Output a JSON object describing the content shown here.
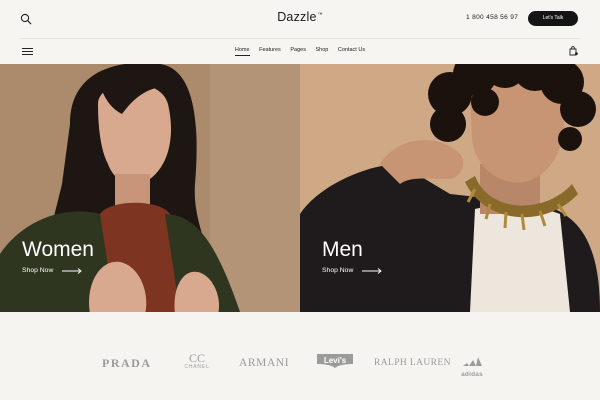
{
  "header": {
    "logo": "Dazzle",
    "logo_mark": "™",
    "phone": "1 800 458 56 97",
    "cta_label": "Let's Talk"
  },
  "nav": {
    "items": [
      {
        "label": "Home",
        "active": true
      },
      {
        "label": "Features",
        "active": false
      },
      {
        "label": "Pages",
        "active": false
      },
      {
        "label": "Shop",
        "active": false
      },
      {
        "label": "Contact Us",
        "active": false
      }
    ]
  },
  "icons": {
    "search": "search-icon",
    "menu": "hamburger-menu-icon",
    "cart": "shopping-bag-icon",
    "arrow": "arrow-right-icon"
  },
  "hero": {
    "women": {
      "title": "Women",
      "link_label": "Shop Now"
    },
    "men": {
      "title": "Men",
      "link_label": "Shop Now"
    }
  },
  "brands": {
    "prada": "PRADA",
    "chanel_mark": "CC",
    "chanel": "CHANEL",
    "armani": "ARMANI",
    "levis": "Levi's",
    "ralph": "RALPH LAUREN",
    "adidas": "adidas"
  },
  "colors": {
    "dark": "#151515",
    "brand_gray": "#9b9b9b",
    "page_bg": "#f6f5f1",
    "women_bg": "#ac8b6d",
    "men_bg": "#cfa885"
  }
}
